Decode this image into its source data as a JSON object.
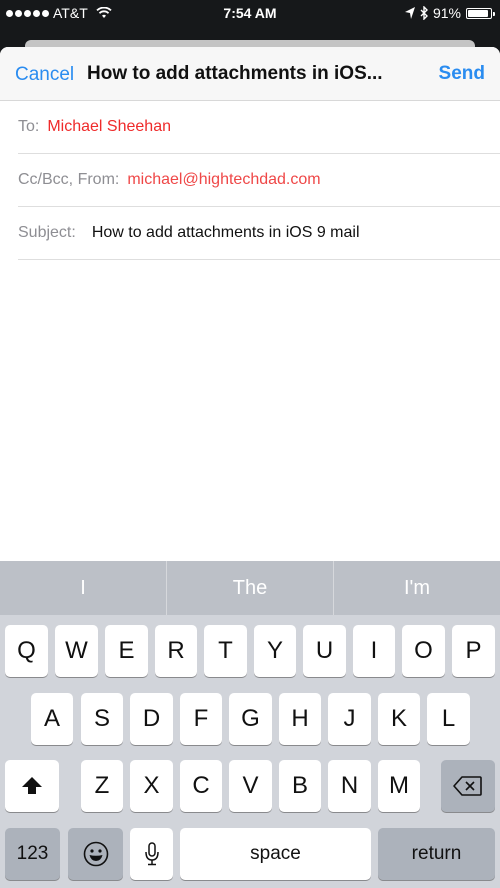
{
  "status_bar": {
    "carrier": "AT&T",
    "time": "7:54 AM",
    "battery": "91%",
    "battery_level": 0.91
  },
  "compose": {
    "cancel_label": "Cancel",
    "title": "How to add attachments in iOS...",
    "send_label": "Send",
    "to_label": "To:",
    "to_value": "Michael Sheehan",
    "from_label": "Cc/Bcc, From:",
    "from_value": "michael@hightechdad.com",
    "subject_label": "Subject:",
    "subject_value": "How to add attachments in iOS 9 mail"
  },
  "keyboard": {
    "predictions": [
      "I",
      "The",
      "I'm"
    ],
    "row1": [
      "Q",
      "W",
      "E",
      "R",
      "T",
      "Y",
      "U",
      "I",
      "O",
      "P"
    ],
    "row2": [
      "A",
      "S",
      "D",
      "F",
      "G",
      "H",
      "J",
      "K",
      "L"
    ],
    "row3": [
      "Z",
      "X",
      "C",
      "V",
      "B",
      "N",
      "M"
    ],
    "numbers_label": "123",
    "space_label": "space",
    "return_label": "return"
  }
}
